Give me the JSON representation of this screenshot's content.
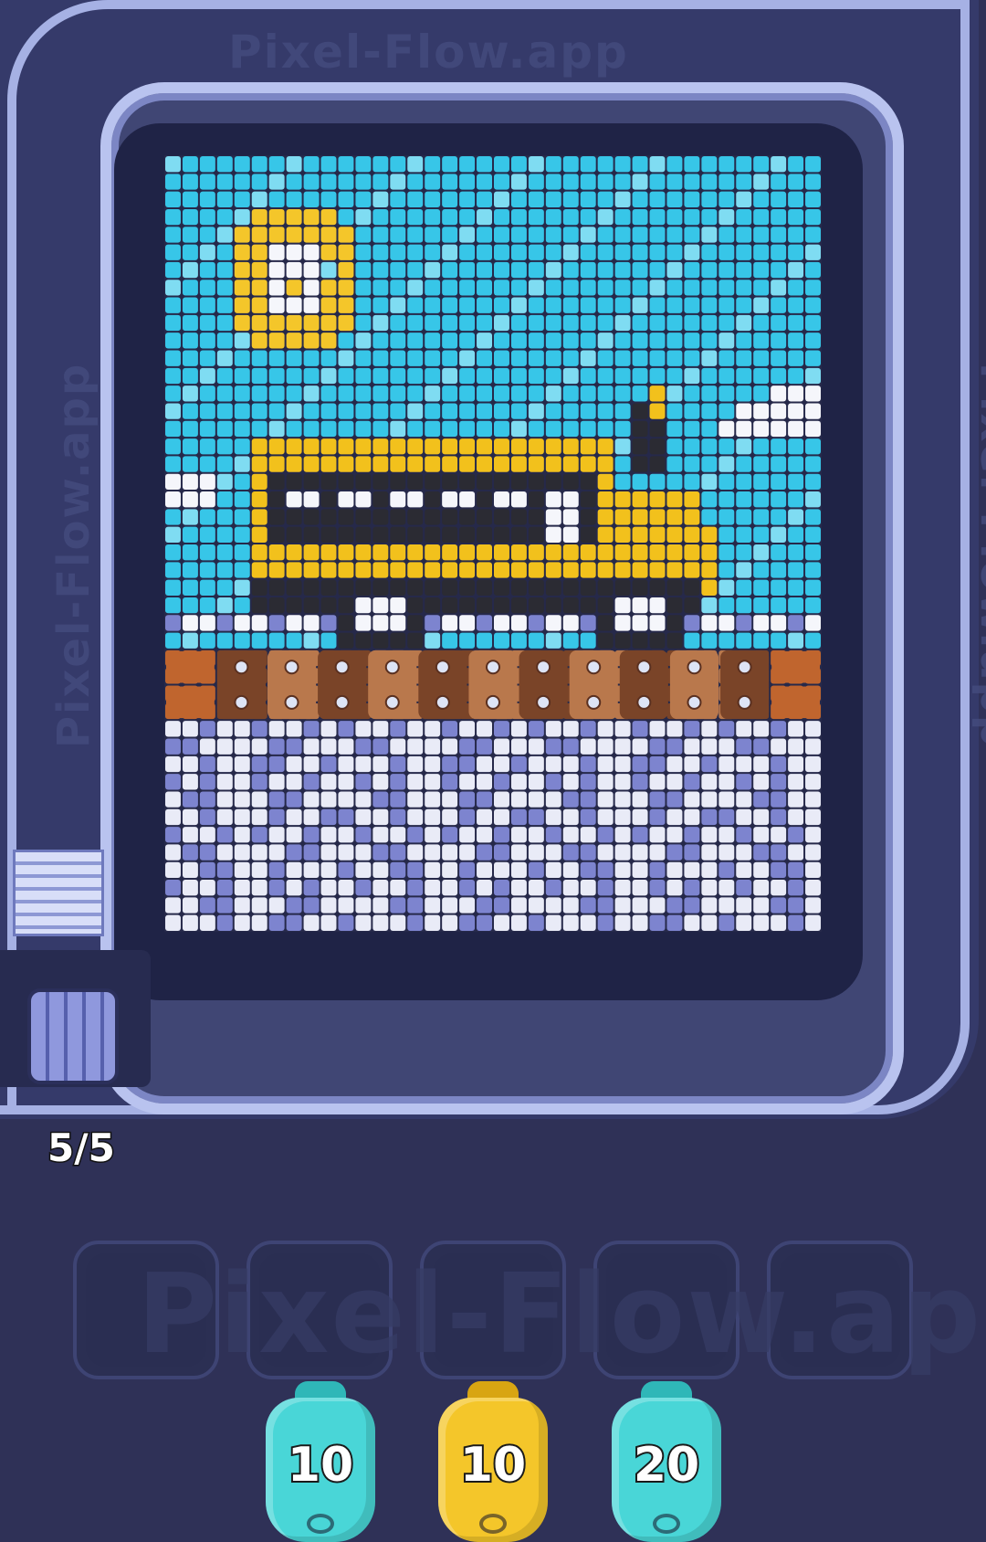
{
  "watermark": {
    "text": "Pixel-Flow.app"
  },
  "board": {
    "columns": 38,
    "rows": 44,
    "palette": {
      "sky": "#37c6e8",
      "sky_light": "#7fdcf2",
      "sun": "#f4c62a",
      "white": "#f5f6fb",
      "bus_yellow": "#f2c11c",
      "black": "#2b2b33",
      "gray": "#5a5d6a",
      "snow_white": "#e9ebf7",
      "snow_blue": "#7d84cf",
      "wood_dark": "#7a4428",
      "wood_light": "#b9784c",
      "fire": "#c0652e"
    }
  },
  "conveyor": {
    "counter": "5/5"
  },
  "slots": {
    "count": 5
  },
  "shooters": [
    {
      "count": "10",
      "color": "#49d6d7",
      "accent": "#2fb7b8"
    },
    {
      "count": "10",
      "color": "#f4c62a",
      "accent": "#d8a512"
    },
    {
      "count": "20",
      "color": "#49d6d7",
      "accent": "#2fb7b8"
    }
  ]
}
